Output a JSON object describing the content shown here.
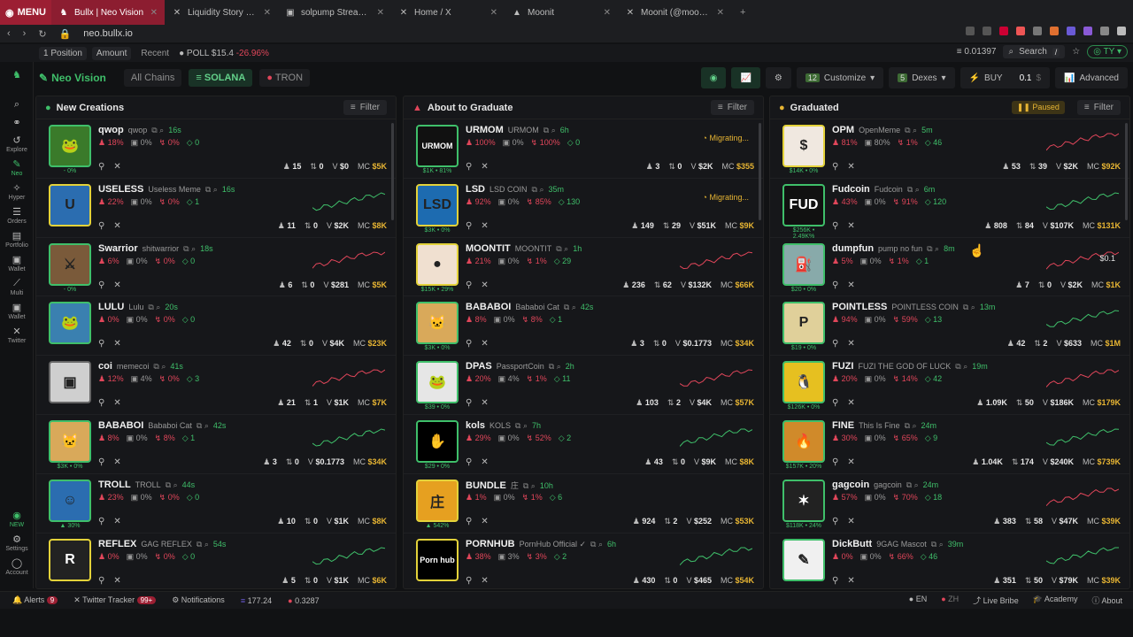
{
  "browser": {
    "menu_label": "MENU",
    "tabs": [
      {
        "title": "Bullx | Neo Vision",
        "active": true
      },
      {
        "title": "Liquidity Story Distributio",
        "active": false
      },
      {
        "title": "solpump Stream - Watch",
        "active": false
      },
      {
        "title": "Home / X",
        "active": false
      },
      {
        "title": "Moonit",
        "active": false
      },
      {
        "title": "Moonit (@moonit) / X",
        "active": false
      }
    ],
    "url": "neo.bullx.io"
  },
  "topstrip": {
    "position": "1 Position",
    "amount": "Amount",
    "recent": "Recent",
    "poll": "POLL $15.4",
    "poll_change": "-26.96%",
    "balance": "0.01397",
    "search": "Search",
    "search_key": "/",
    "wallet": "TY"
  },
  "sidebar": [
    {
      "label": "",
      "icon": "search-icon"
    },
    {
      "label": "",
      "icon": "link-icon"
    },
    {
      "label": "Explore",
      "icon": "history-icon"
    },
    {
      "label": "Neo",
      "icon": "neo-icon"
    },
    {
      "label": "Hyper",
      "icon": "hyper-icon"
    },
    {
      "label": "Orders",
      "icon": "orders-icon"
    },
    {
      "label": "Portfolio",
      "icon": "portfolio-icon"
    },
    {
      "label": "Wallet",
      "icon": "wallet-icon"
    },
    {
      "label": "Multi",
      "icon": "chart-icon"
    },
    {
      "label": "Wallet",
      "icon": "wallet2-icon"
    },
    {
      "label": "Twitter",
      "icon": "x-icon"
    }
  ],
  "sidebar_bottom": {
    "settings": "Settings",
    "account": "Account"
  },
  "header": {
    "brand": "Neo Vision",
    "chains": [
      "All Chains",
      "SOLANA",
      "TRON"
    ],
    "customize_count": "12",
    "customize": "Customize",
    "dexes_count": "5",
    "dexes": "Dexes",
    "buy": "BUY",
    "buy_amount": "0.1",
    "advanced": "Advanced"
  },
  "columns": {
    "new": {
      "title": "New Creations",
      "filter": "Filter",
      "rows": [
        {
          "ticker": "qwop",
          "name": "qwop",
          "age": "16s",
          "s1": "18%",
          "s2": "0%",
          "s3": "0%",
          "s4": "0",
          "holders": "15",
          "tx": "0",
          "v": "$0",
          "mc": "$5K",
          "avatar": "#3a7a2a",
          "glyph": "🐸",
          "sub": "- 0%",
          "bd": ""
        },
        {
          "ticker": "USELESS",
          "name": "Useless Meme",
          "age": "16s",
          "s1": "22%",
          "s2": "0%",
          "s3": "0%",
          "s4": "1",
          "holders": "11",
          "tx": "0",
          "v": "$2K",
          "mc": "$8K",
          "avatar": "#2b6db0",
          "glyph": "U",
          "sub": "",
          "bd": "y"
        },
        {
          "ticker": "Swarrior",
          "name": "shitwarrior",
          "age": "18s",
          "s1": "6%",
          "s2": "0%",
          "s3": "0%",
          "s4": "0",
          "holders": "6",
          "tx": "0",
          "v": "$281",
          "mc": "$5K",
          "avatar": "#7a5a3a",
          "glyph": "⚔",
          "sub": "- 0%",
          "bd": ""
        },
        {
          "ticker": "LULU",
          "name": "Lulu",
          "age": "20s",
          "s1": "0%",
          "s2": "0%",
          "s3": "0%",
          "s4": "0",
          "holders": "42",
          "tx": "0",
          "v": "$4K",
          "mc": "$23K",
          "avatar": "#3a80b0",
          "glyph": "🐸",
          "sub": "",
          "bd": ""
        },
        {
          "ticker": "coi",
          "name": "memecoi",
          "age": "41s",
          "s1": "12%",
          "s2": "4%",
          "s3": "0%",
          "s4": "3",
          "holders": "21",
          "tx": "1",
          "v": "$1K",
          "mc": "$7K",
          "avatar": "#cfcfcf",
          "glyph": "▣",
          "sub": "",
          "bd": "gr"
        },
        {
          "ticker": "BABABOI",
          "name": "Bababoi Cat",
          "age": "42s",
          "s1": "8%",
          "s2": "0%",
          "s3": "8%",
          "s4": "1",
          "holders": "3",
          "tx": "0",
          "v": "$0.1773",
          "mc": "$34K",
          "avatar": "#d9a95a",
          "glyph": "🐱",
          "sub": "$3K • 0%",
          "bd": ""
        },
        {
          "ticker": "TROLL",
          "name": "TROLL",
          "age": "44s",
          "s1": "23%",
          "s2": "0%",
          "s3": "0%",
          "s4": "0",
          "holders": "10",
          "tx": "0",
          "v": "$1K",
          "mc": "$8K",
          "avatar": "#2b6db0",
          "glyph": "☺",
          "sub": "▲ 30%",
          "bd": ""
        },
        {
          "ticker": "REFLEX",
          "name": "GAG REFLEX",
          "age": "54s",
          "s1": "0%",
          "s2": "0%",
          "s3": "0%",
          "s4": "0",
          "holders": "5",
          "tx": "0",
          "v": "$1K",
          "mc": "$6K",
          "avatar": "#222",
          "glyph": "R",
          "sub": "",
          "bd": "y"
        }
      ]
    },
    "graduate": {
      "title": "About to Graduate",
      "filter": "Filter",
      "migrating": "Migrating...",
      "rows": [
        {
          "ticker": "URMOM",
          "name": "URMOM",
          "age": "6h",
          "s1": "100%",
          "s2": "0%",
          "s3": "100%",
          "s4": "0",
          "holders": "3",
          "tx": "0",
          "v": "$2K",
          "mc": "$355",
          "avatar": "#111",
          "glyph": "URMOM",
          "sub": "$1K • 81%",
          "bd": "",
          "mig": true
        },
        {
          "ticker": "LSD",
          "name": "LSD COIN",
          "age": "35m",
          "s1": "92%",
          "s2": "0%",
          "s3": "85%",
          "s4": "130",
          "holders": "149",
          "tx": "29",
          "v": "$51K",
          "mc": "$9K",
          "avatar": "#1d6bb0",
          "glyph": "LSD",
          "sub": "$3K • 0%",
          "bd": "y",
          "mig": true
        },
        {
          "ticker": "MOONTIT",
          "name": "MOONTIT",
          "age": "1h",
          "s1": "21%",
          "s2": "0%",
          "s3": "1%",
          "s4": "29",
          "holders": "236",
          "tx": "62",
          "v": "$132K",
          "mc": "$66K",
          "avatar": "#f0e0d0",
          "glyph": "●",
          "sub": "$15K • 29%",
          "bd": "y",
          "mig": false
        },
        {
          "ticker": "BABABOI",
          "name": "Bababoi Cat",
          "age": "42s",
          "s1": "8%",
          "s2": "0%",
          "s3": "8%",
          "s4": "1",
          "holders": "3",
          "tx": "0",
          "v": "$0.1773",
          "mc": "$34K",
          "avatar": "#d9a95a",
          "glyph": "🐱",
          "sub": "$3K • 0%",
          "bd": "",
          "mig": false
        },
        {
          "ticker": "DPAS",
          "name": "PassportCoin",
          "age": "2h",
          "s1": "20%",
          "s2": "4%",
          "s3": "1%",
          "s4": "11",
          "holders": "103",
          "tx": "2",
          "v": "$4K",
          "mc": "$57K",
          "avatar": "#e6e6e6",
          "glyph": "🐸",
          "sub": "$39 • 0%",
          "bd": "",
          "mig": false
        },
        {
          "ticker": "kols",
          "name": "KOLS",
          "age": "7h",
          "s1": "29%",
          "s2": "0%",
          "s3": "52%",
          "s4": "2",
          "holders": "43",
          "tx": "0",
          "v": "$9K",
          "mc": "$8K",
          "avatar": "#000",
          "glyph": "✋",
          "sub": "$29 • 0%",
          "bd": "",
          "mig": false
        },
        {
          "ticker": "BUNDLE",
          "name": "庄",
          "age": "10h",
          "s1": "1%",
          "s2": "0%",
          "s3": "1%",
          "s4": "6",
          "holders": "924",
          "tx": "2",
          "v": "$252",
          "mc": "$53K",
          "avatar": "#e6a020",
          "glyph": "庄",
          "sub": "▲ 542%",
          "bd": "y",
          "mig": false
        },
        {
          "ticker": "PORNHUB",
          "name": "PornHub Official ✓",
          "age": "6h",
          "s1": "38%",
          "s2": "3%",
          "s3": "3%",
          "s4": "2",
          "holders": "430",
          "tx": "0",
          "v": "$465",
          "mc": "$54K",
          "avatar": "#000",
          "glyph": "Porn hub",
          "sub": "",
          "bd": "y",
          "mig": false
        }
      ]
    },
    "graduated": {
      "title": "Graduated",
      "paused": "Paused",
      "filter": "Filter",
      "rows": [
        {
          "ticker": "OPM",
          "name": "OpenMeme",
          "age": "5m",
          "s1": "81%",
          "s2": "80%",
          "s3": "1%",
          "s4": "46",
          "holders": "53",
          "tx": "39",
          "v": "$2K",
          "mc": "$92K",
          "avatar": "#f0e8e0",
          "glyph": "$",
          "sub": "$14K • 0%",
          "bd": "y",
          "extra": ""
        },
        {
          "ticker": "Fudcoin",
          "name": "Fudcoin",
          "age": "6m",
          "s1": "43%",
          "s2": "0%",
          "s3": "91%",
          "s4": "120",
          "holders": "808",
          "tx": "84",
          "v": "$107K",
          "mc": "$131K",
          "avatar": "#111",
          "glyph": "FUD",
          "sub": "$256K • 2.49K%",
          "bd": "",
          "extra": ""
        },
        {
          "ticker": "dumpfun",
          "name": "pump no fun",
          "age": "8m",
          "s1": "5%",
          "s2": "0%",
          "s3": "1%",
          "s4": "1",
          "holders": "7",
          "tx": "0",
          "v": "$2K",
          "mc": "$1K",
          "avatar": "#8aa",
          "glyph": "⛽",
          "sub": "$20 • 0%",
          "bd": "",
          "extra": "$0.1"
        },
        {
          "ticker": "POINTLESS",
          "name": "POINTLESS COIN",
          "age": "13m",
          "s1": "94%",
          "s2": "0%",
          "s3": "59%",
          "s4": "13",
          "holders": "42",
          "tx": "2",
          "v": "$633",
          "mc": "$1M",
          "avatar": "#e0d09a",
          "glyph": "P",
          "sub": "$19 • 0%",
          "bd": "",
          "extra": ""
        },
        {
          "ticker": "FUZI",
          "name": "FUZI THE GOD OF LUCK",
          "age": "19m",
          "s1": "20%",
          "s2": "0%",
          "s3": "14%",
          "s4": "42",
          "holders": "1.09K",
          "tx": "50",
          "v": "$186K",
          "mc": "$179K",
          "avatar": "#e6c020",
          "glyph": "🐧",
          "sub": "$126K • 0%",
          "bd": "",
          "extra": ""
        },
        {
          "ticker": "FINE",
          "name": "This Is Fine",
          "age": "24m",
          "s1": "30%",
          "s2": "0%",
          "s3": "65%",
          "s4": "9",
          "holders": "1.04K",
          "tx": "174",
          "v": "$240K",
          "mc": "$739K",
          "avatar": "#d08a2a",
          "glyph": "🔥",
          "sub": "$157K • 20%",
          "bd": "",
          "extra": ""
        },
        {
          "ticker": "gagcoin",
          "name": "gagcoin",
          "age": "24m",
          "s1": "57%",
          "s2": "0%",
          "s3": "70%",
          "s4": "18",
          "holders": "383",
          "tx": "58",
          "v": "$47K",
          "mc": "$39K",
          "avatar": "#222",
          "glyph": "✶",
          "sub": "$118K • 24%",
          "bd": "",
          "extra": ""
        },
        {
          "ticker": "DickButt",
          "name": "9GAG Mascot",
          "age": "39m",
          "s1": "0%",
          "s2": "0%",
          "s3": "66%",
          "s4": "46",
          "holders": "351",
          "tx": "50",
          "v": "$79K",
          "mc": "$39K",
          "avatar": "#f0f0f0",
          "glyph": "✎",
          "sub": "",
          "bd": "",
          "extra": ""
        }
      ]
    }
  },
  "bottombar": {
    "alerts": "Alerts",
    "alerts_count": "9",
    "twitter": "Twitter Tracker",
    "twitter_count": "99+",
    "notifications": "Notifications",
    "sol": "177.24",
    "other": "0.3287",
    "lang_en": "EN",
    "lang_zh": "ZH",
    "bribe": "Live Bribe",
    "academy": "Academy",
    "about": "About"
  }
}
